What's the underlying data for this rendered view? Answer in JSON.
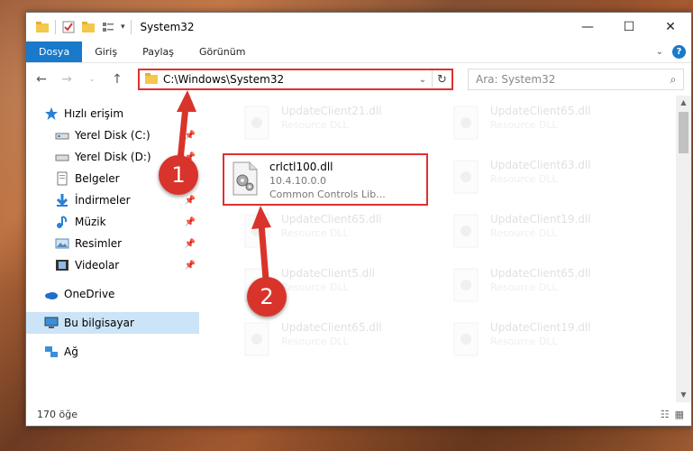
{
  "window": {
    "title": "System32",
    "controls": {
      "minimize": "—",
      "maximize": "☐",
      "close": "✕"
    }
  },
  "ribbon": {
    "tabs": [
      "Dosya",
      "Giriş",
      "Paylaş",
      "Görünüm"
    ],
    "help": "?"
  },
  "navigation": {
    "address": "C:\\Windows\\System32",
    "search_placeholder": "Ara: System32"
  },
  "sidebar": {
    "quick_access": "Hızlı erişim",
    "items": [
      {
        "label": "Yerel Disk (C:)",
        "icon": "drive-icon"
      },
      {
        "label": "Yerel Disk (D:)",
        "icon": "drive-icon"
      },
      {
        "label": "Belgeler",
        "icon": "documents-icon"
      },
      {
        "label": "İndirmeler",
        "icon": "downloads-icon"
      },
      {
        "label": "Müzik",
        "icon": "music-icon"
      },
      {
        "label": "Resimler",
        "icon": "pictures-icon"
      },
      {
        "label": "Videolar",
        "icon": "videos-icon"
      }
    ],
    "onedrive": "OneDrive",
    "this_pc": "Bu bilgisayar",
    "network": "Ağ"
  },
  "files": {
    "highlighted": {
      "name": "crlctl100.dll",
      "version": "10.4.10.0.0",
      "description": "Common Controls Lib..."
    },
    "tiles": [
      {
        "name": "UpdateClient21.dll",
        "type": "Resource DLL"
      },
      {
        "name": "UpdateClient65.dll",
        "type": "Resource DLL"
      },
      {
        "name": "UpdateClient63.dll",
        "type": "Resource DLL"
      },
      {
        "name": "UpdateClient65.dll",
        "type": "Resource DLL"
      },
      {
        "name": "UpdateClient19.dll",
        "type": "Resource DLL"
      },
      {
        "name": "UpdateClient5.dll",
        "type": "Resource DLL"
      },
      {
        "name": "UpdateClient65.dll",
        "type": "Resource DLL"
      },
      {
        "name": "UpdateClient65.dll",
        "type": "Resource DLL"
      },
      {
        "name": "UpdateClient19.dll",
        "type": "Resource DLL"
      }
    ]
  },
  "status": {
    "count": "170 öğe"
  },
  "annotations": {
    "step1": "1",
    "step2": "2",
    "color": "#d9342b"
  }
}
